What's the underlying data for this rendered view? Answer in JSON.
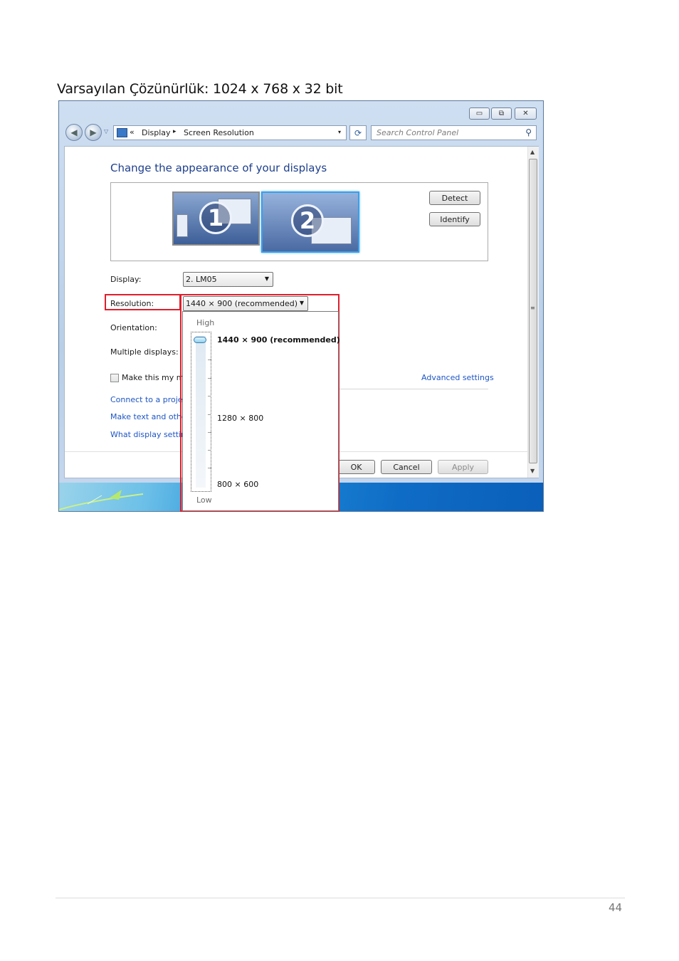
{
  "document": {
    "heading": "Varsayılan Çözünürlük: 1024 x 768 x 32 bit",
    "page_number": "44"
  },
  "window": {
    "caption_buttons": {
      "minimize": "▭",
      "maximize": "⧉",
      "close": "✕"
    },
    "address": {
      "chevron": "«",
      "crumb1": "Display",
      "separator": "▸",
      "crumb2": "Screen Resolution",
      "dropdown_arrow": "▾"
    },
    "refresh_icon": "⟳",
    "search": {
      "placeholder": "Search Control Panel",
      "icon": "⚲"
    }
  },
  "panel": {
    "title": "Change the appearance of your displays",
    "monitors": [
      {
        "number": "1",
        "selected": false
      },
      {
        "number": "2",
        "selected": true
      }
    ],
    "detect_label": "Detect",
    "identify_label": "Identify",
    "display_label": "Display:",
    "display_value": "2. LM05",
    "resolution_label": "Resolution:",
    "resolution_value": "1440 × 900 (recommended)",
    "orientation_label": "Orientation:",
    "multiple_label": "Multiple displays:",
    "checkbox_label": "Make this my m",
    "advanced_link": "Advanced settings",
    "links": [
      "Connect to a projec",
      "Make text and othe",
      "What display settin"
    ],
    "ok_label": "OK",
    "cancel_label": "Cancel",
    "apply_label": "Apply"
  },
  "resolution_dropdown": {
    "high_label": "High",
    "low_label": "Low",
    "options": [
      "1440 × 900 (recommended)",
      "1280 × 800",
      "800 × 600"
    ],
    "selected_index": 0,
    "slider_level": 1.0
  },
  "colors": {
    "highlight_red": "#dd1f2c",
    "link_blue": "#1e56c4",
    "heading_blue": "#1e3f8c"
  }
}
